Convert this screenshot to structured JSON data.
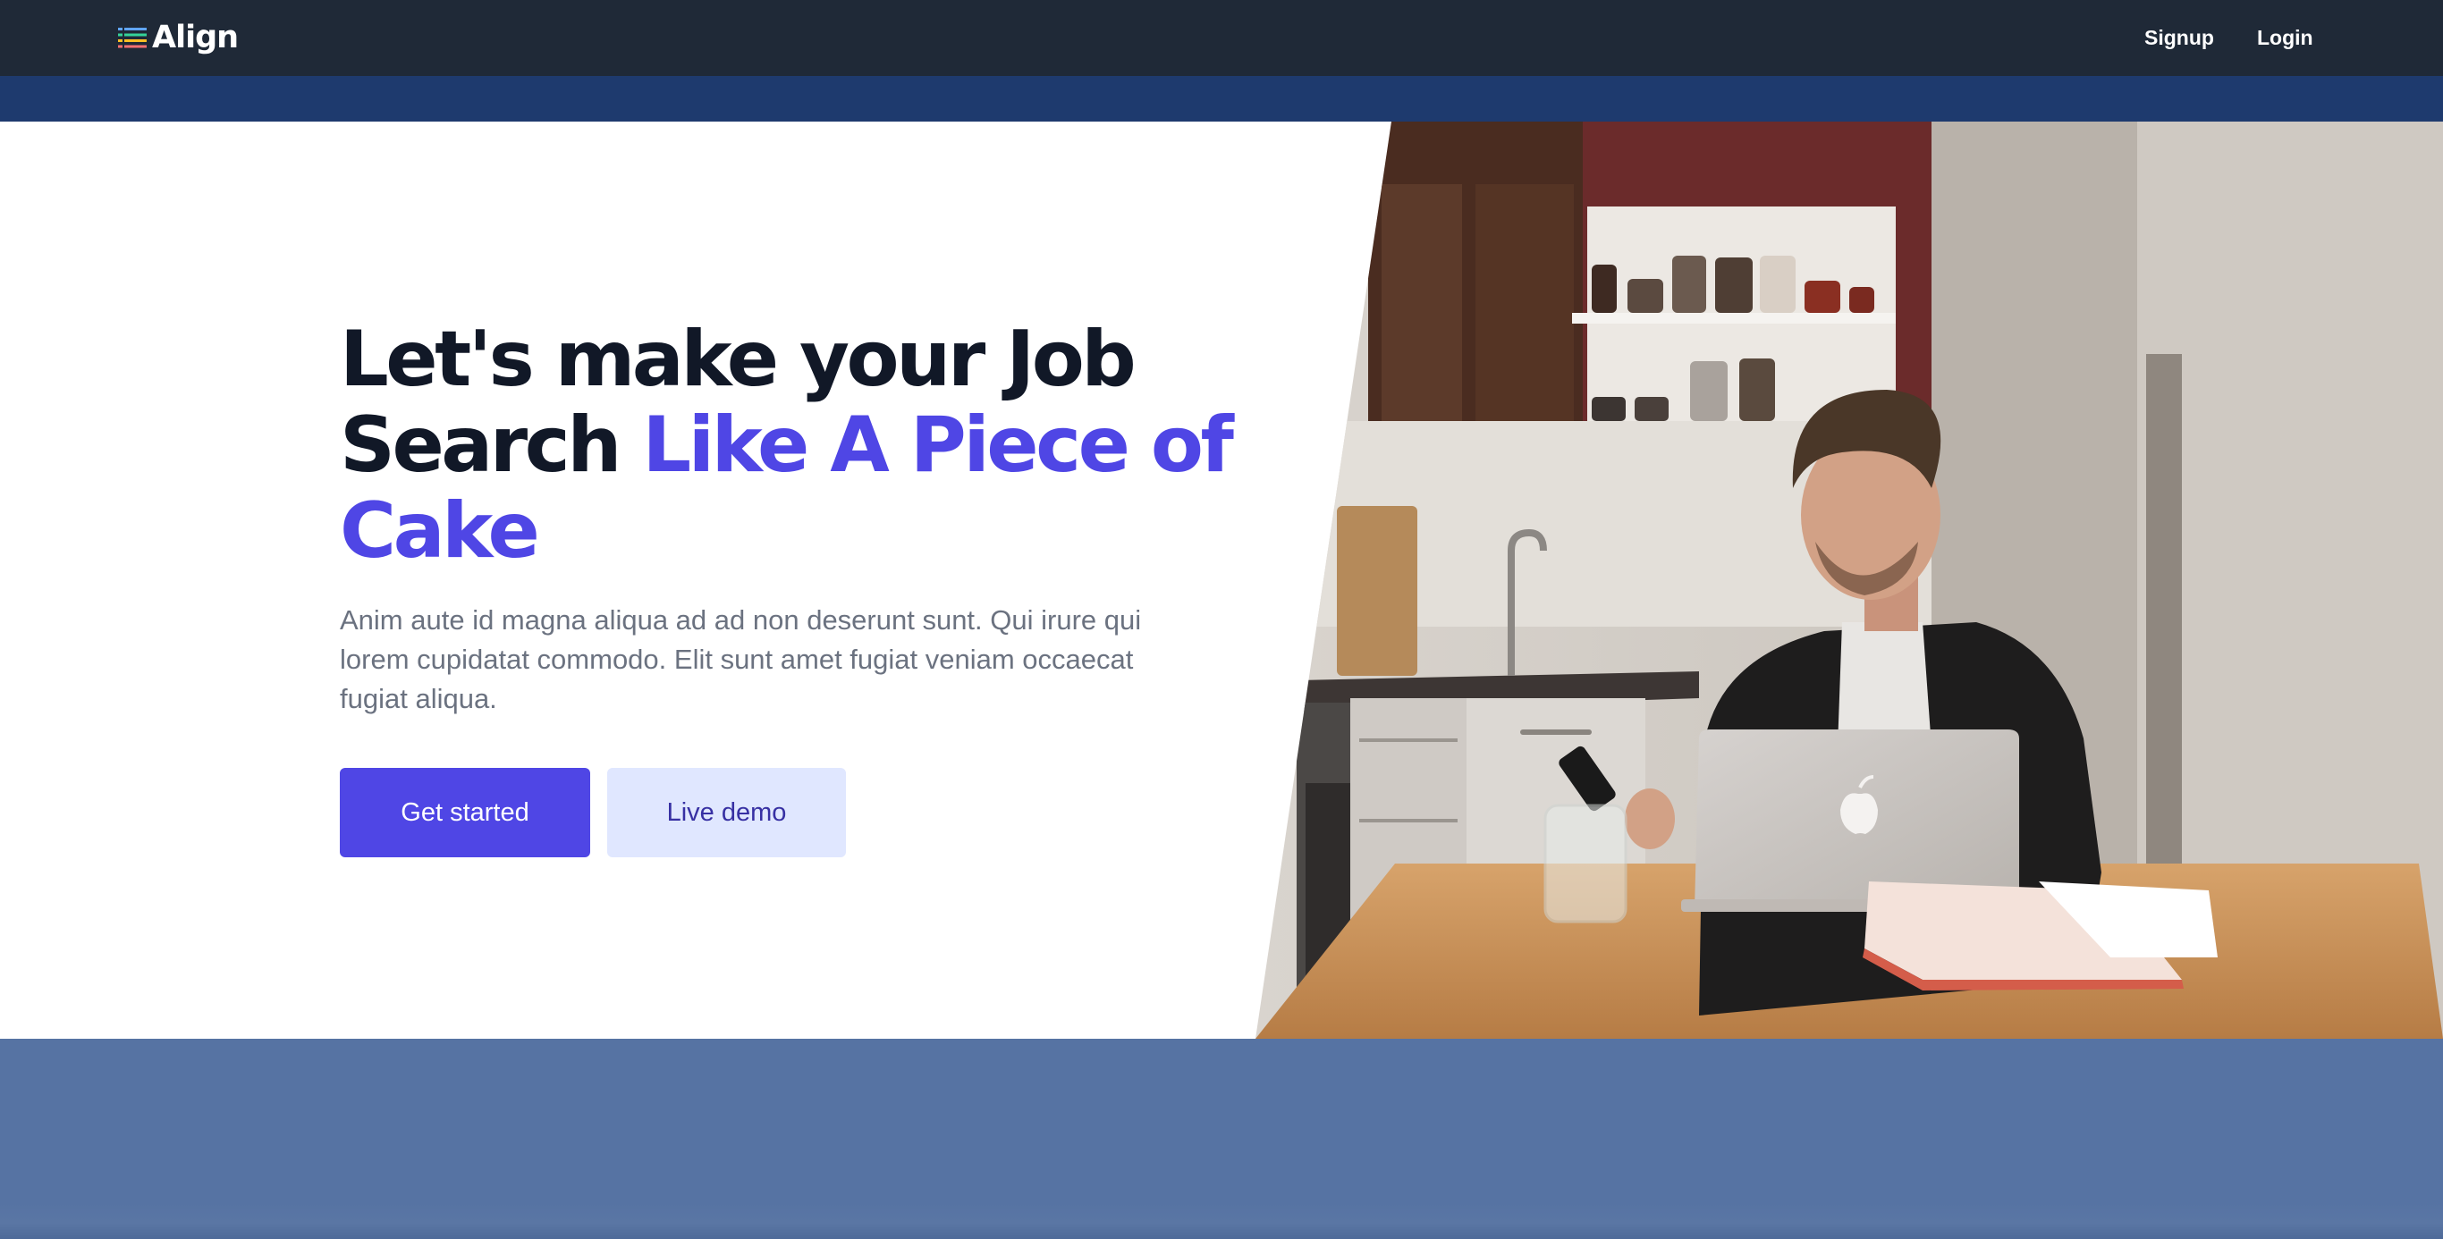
{
  "brand": {
    "name": "Align",
    "icon": "list-icon"
  },
  "nav": {
    "signup_label": "Signup",
    "login_label": "Login"
  },
  "hero": {
    "headline_part1": "Let's make your Job Search ",
    "headline_accent": "Like A Piece of Cake",
    "subtext": "Anim aute id magna aliqua ad ad non deserunt sunt. Qui irure qui lorem cupidatat commodo. Elit sunt amet fugiat veniam occaecat fugiat aliqua.",
    "primary_button": "Get started",
    "secondary_button": "Live demo",
    "image_subject": "man-using-phone-at-laptop-in-kitchen"
  },
  "colors": {
    "navbar": "#1f2937",
    "strip": "#1e3a6e",
    "accent": "#4f46e5",
    "secondary_button_bg": "#e0e7ff",
    "secondary_button_text": "#3730a3",
    "headline": "#111827",
    "subtext": "#6b7280",
    "bottom_band": "#5673a3"
  }
}
